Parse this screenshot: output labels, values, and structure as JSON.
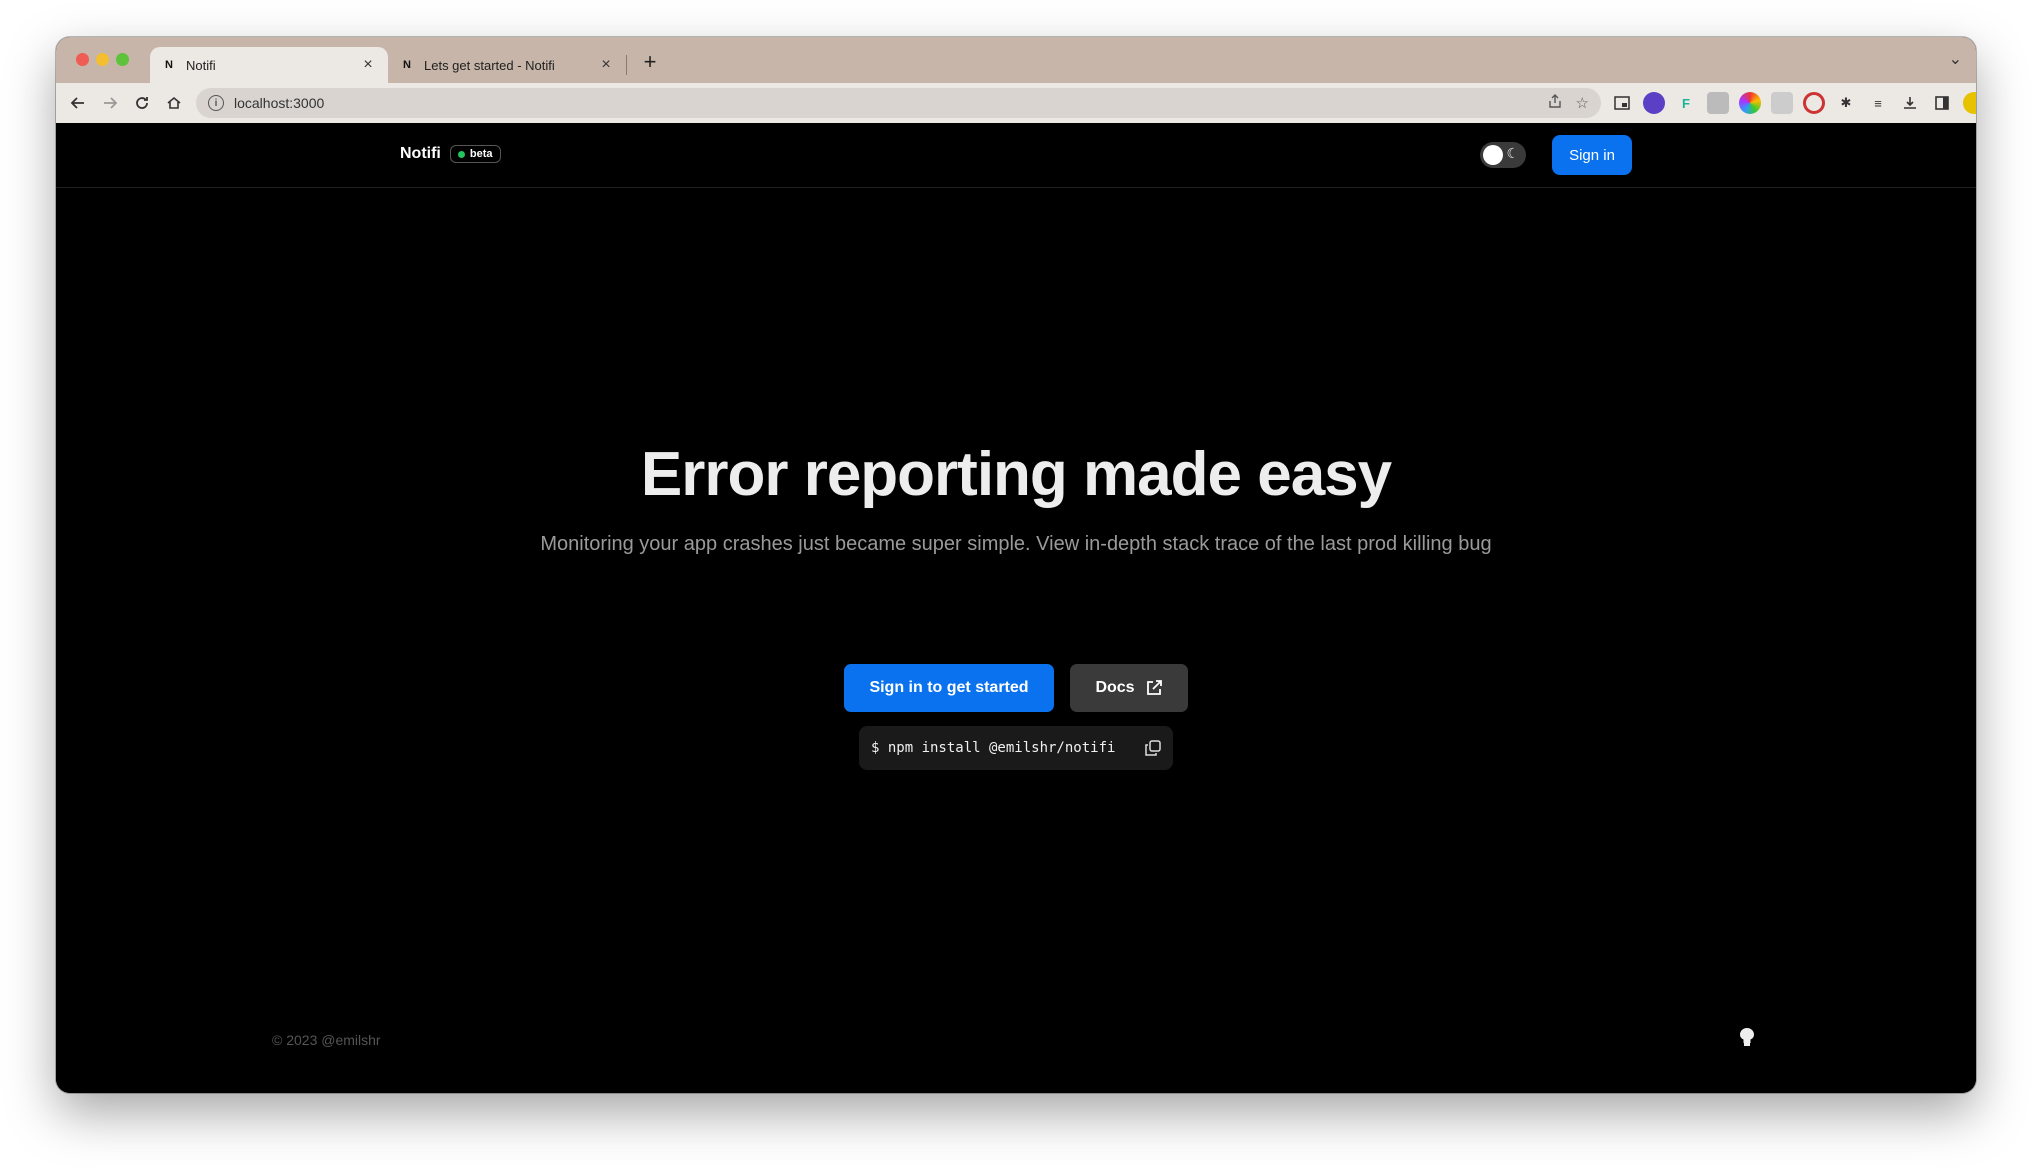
{
  "browser": {
    "tabs": [
      {
        "favicon": "N",
        "title": "Notifi",
        "active": true
      },
      {
        "favicon": "N",
        "title": "Lets get started - Notifi",
        "active": false
      }
    ],
    "close_glyph": "×",
    "new_tab_glyph": "+",
    "tab_list_glyph": "⌄",
    "url": "localhost:3000",
    "icons": [
      "back-icon",
      "forward-icon",
      "reload-icon",
      "home-icon",
      "info-icon",
      "share-icon",
      "bookmark-star-icon",
      "puzzle-extensions-icon",
      "download-icon",
      "sidebar-icon",
      "profile-avatar-icon",
      "menu-kebab-icon"
    ]
  },
  "header": {
    "brand": "Notifi",
    "badge": "beta",
    "badge_dot_color": "#22c55e",
    "sign_in": "Sign in"
  },
  "hero": {
    "title": "Error reporting made easy",
    "subtitle": "Monitoring your app crashes just became super simple. View in-depth stack trace of the last prod killing bug",
    "cta_primary": "Sign in to get started",
    "cta_docs": "Docs",
    "install_cmd": "$ npm install @emilshr/notifi"
  },
  "footer": {
    "copyright": "© 2023 @emilshr"
  },
  "colors": {
    "accent": "#0a72ef",
    "page_bg": "#000000",
    "secondary_button": "#3a3a3a"
  }
}
